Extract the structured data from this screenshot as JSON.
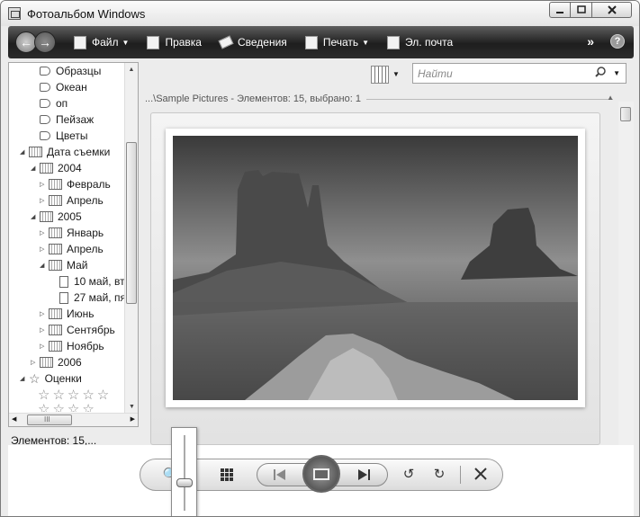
{
  "window": {
    "title": "Фотоальбом Windows"
  },
  "toolbar": {
    "file": "Файл",
    "fix": "Правка",
    "info": "Сведения",
    "print": "Печать",
    "email": "Эл. почта",
    "more": "»",
    "help": "?"
  },
  "sidebar": {
    "tags": [
      "Образцы",
      "Океан",
      "оп",
      "Пейзаж",
      "Цветы"
    ],
    "date_taken": "Дата съемки",
    "year_2004": "2004",
    "months_2004": [
      "Февраль",
      "Апрель"
    ],
    "year_2005": "2005",
    "months_2005_a": [
      "Январь",
      "Апрель",
      "Май"
    ],
    "may_days": [
      "10 май, вт",
      "27 май, пя"
    ],
    "months_2005_b": [
      "Июнь",
      "Сентябрь",
      "Ноябрь"
    ],
    "year_2006": "2006",
    "ratings": "Оценки",
    "hscroll_grip": "III"
  },
  "main": {
    "search_placeholder": "Найти",
    "path": "...\\Sample Pictures - Элементов: 15, выбрано: 1"
  },
  "status": {
    "text": "Элементов: 15,..."
  },
  "controls": {
    "zoom_level": 0.35
  }
}
